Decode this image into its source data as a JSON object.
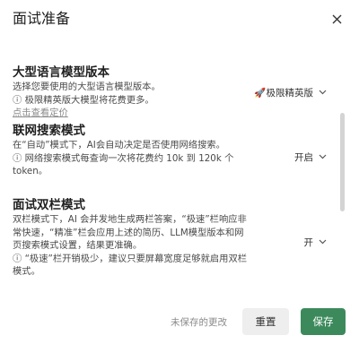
{
  "dialog": {
    "title": "面试准备"
  },
  "model": {
    "title": "大型语言模型版本",
    "desc": "选择您要使用的大型语言模型版本。",
    "note": "ⓘ 极限精英版大模型将花费更多。",
    "link": "点击查看定价",
    "select_value": "🚀极限精英版"
  },
  "search": {
    "title": "联网搜索模式",
    "desc": "在“自动”模式下，AI会自动决定是否使用网络搜索。",
    "note": "ⓘ 网络搜索模式每查询一次将花费约 10k 到 120k 个 token。",
    "select_value": "开启"
  },
  "dual": {
    "title": "面试双栏模式",
    "desc": "双栏模式下，AI 会并发地生成两栏答案，“极速”栏响应非常快速，“精准”栏会应用上述的简历、LLM模型版本和网页搜索模式设置，结果更准确。",
    "note": "ⓘ “极速”栏开销极少，建议只要屏幕宽度足够就启用双栏模式。",
    "select_value": "开"
  },
  "footer": {
    "unsaved": "未保存的更改",
    "reset_label": "重置",
    "save_label": "保存"
  },
  "colors": {
    "primary": "#3c8a5c",
    "reset_bg": "#eeeeee",
    "scrollbar": "#d4d4d4"
  },
  "icons": {
    "close": "close-icon",
    "chevron": "chevron-down-icon"
  }
}
